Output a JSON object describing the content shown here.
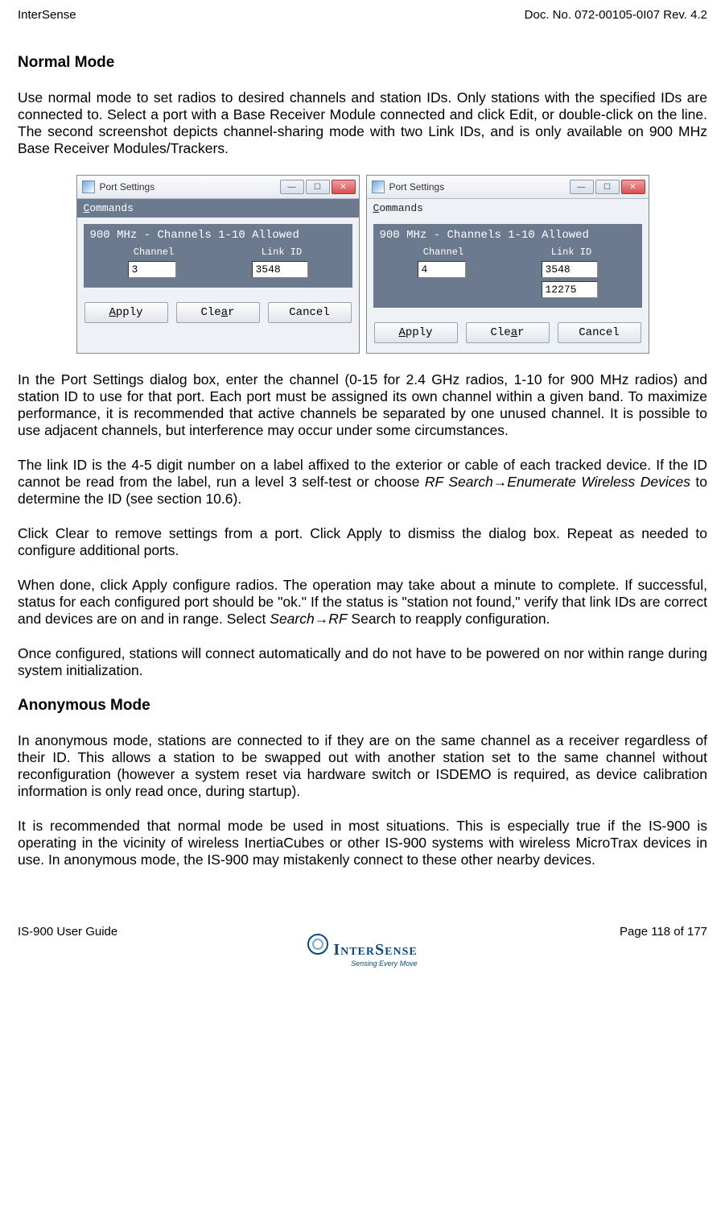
{
  "header": {
    "left": "InterSense",
    "right": "Doc. No. 072-00105-0I07 Rev. 4.2"
  },
  "section1_title": "Normal Mode",
  "para1": "Use normal mode to set radios to desired channels and station IDs. Only stations with the specified IDs are connected to. Select a port with a Base Receiver Module connected and click Edit, or double-click on the line.  The second screenshot depicts channel-sharing mode with two Link IDs, and is only available on 900 MHz Base Receiver Modules/Trackers.",
  "dialog1": {
    "title": "Port Settings",
    "menu": "Commands",
    "panel_title": "900 MHz - Channels 1-10 Allowed",
    "col1": "Channel",
    "col2": "Link ID",
    "channel_value": "3",
    "linkid_value": "3548",
    "btn_apply": "Apply",
    "btn_clear": "Clear",
    "btn_cancel": "Cancel"
  },
  "dialog2": {
    "title": "Port Settings",
    "menu": "Commands",
    "panel_title": "900 MHz - Channels 1-10 Allowed",
    "col1": "Channel",
    "col2": "Link ID",
    "channel_value": "4",
    "linkid_value1": "3548",
    "linkid_value2": "12275",
    "btn_apply": "Apply",
    "btn_clear": "Clear",
    "btn_cancel": "Cancel"
  },
  "para2": "In the Port Settings dialog box, enter the channel (0-15 for 2.4 GHz radios, 1-10 for 900 MHz radios) and station ID to use for that port. Each port must be assigned its own channel within a given band. To maximize performance, it is recommended that active channels be separated by one unused channel. It is possible to use adjacent channels, but interference may occur under some circumstances.",
  "para3_a": "The link ID is the 4-5 digit number on a label affixed to the exterior or cable of each tracked device. If the ID cannot be read from the label, run a level 3 self-test or choose ",
  "para3_italic": "RF Search→Enumerate Wireless Devices",
  "para3_b": " to determine the ID (see section 10.6).",
  "para4": "Click Clear to remove settings from a port. Click Apply to dismiss the dialog box. Repeat as needed to configure additional ports.",
  "para5_a": "When done, click Apply configure radios. The operation may take about a minute to complete. If successful, status for each configured port should be \"ok.\" If the status is \"station not found,\" verify that link IDs are correct and devices are on and in range. Select ",
  "para5_italic": "Search→RF",
  "para5_b": " Search to reapply configuration.",
  "para6": "Once configured, stations will connect automatically and do not have to be powered on nor within range during system initialization.",
  "section2_title": "Anonymous Mode",
  "para7": "In anonymous mode, stations are connected to if they are on the same channel as a receiver regardless of their ID. This allows a station to be swapped out with another station set to the same channel without reconfiguration (however a system reset via hardware switch or ISDEMO is required, as device calibration information is only read once, during startup).",
  "para8": "It is recommended that normal mode be used in most situations. This is especially true if the IS-900 is operating in the vicinity of wireless InertiaCubes or other IS-900 systems with wireless MicroTrax devices in use. In anonymous mode, the IS-900 may mistakenly connect to these other nearby devices.",
  "footer": {
    "left": "IS-900 User Guide",
    "right": "Page 118 of 177",
    "logo_text": "InterSense",
    "logo_sub": "Sensing Every Move"
  }
}
